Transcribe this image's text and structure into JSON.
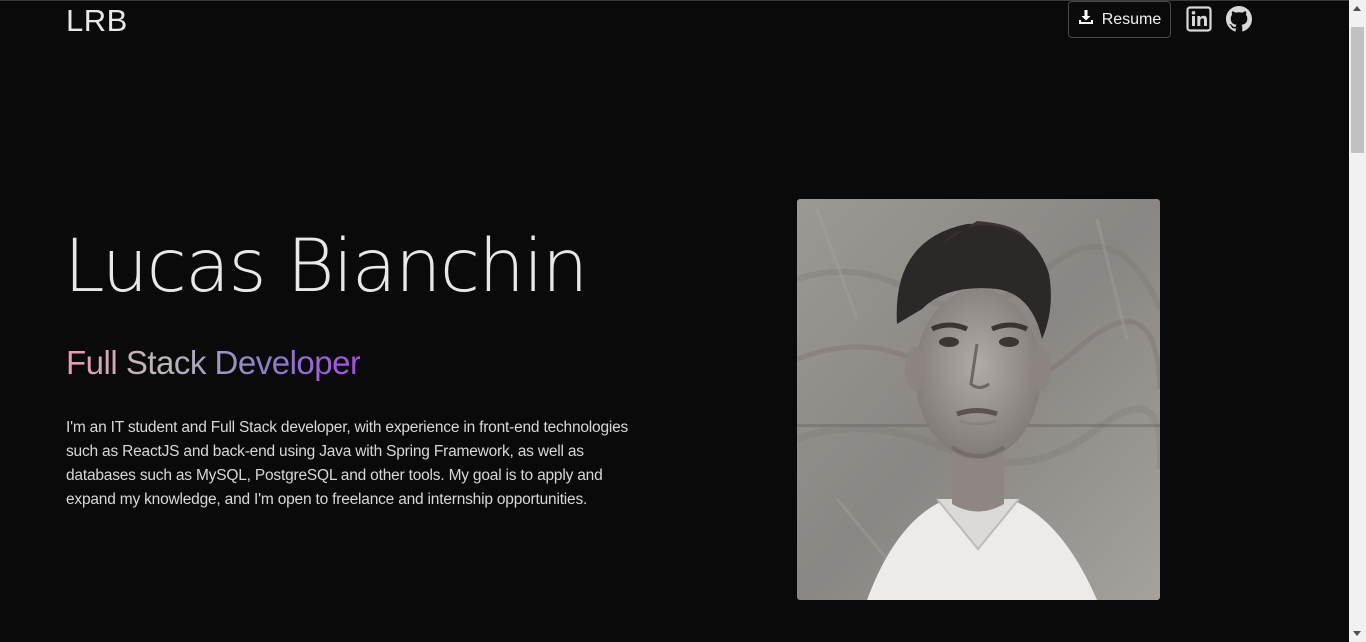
{
  "header": {
    "logo": "LRB",
    "resume_label": "Resume",
    "icons": [
      "download-icon",
      "linkedin-icon",
      "github-icon"
    ]
  },
  "hero": {
    "name": "Lucas Bianchin",
    "role": "Full Stack Developer",
    "bio": "I'm an IT student and Full Stack developer, with experience in front-end technologies such as ReactJS and back-end using Java with Spring Framework, as well as databases such as MySQL, PostgreSQL and other tools. My goal is to apply and expand my knowledge, and I'm open to freelance and internship opportunities.",
    "photo_alt": "Lucas Bianchin"
  },
  "colors": {
    "background": "#0a0a0b",
    "text": "#e8e8e8",
    "gradient": [
      "#e79ab7",
      "#b9b9b9",
      "#8c82c7",
      "#a44fe0"
    ]
  }
}
